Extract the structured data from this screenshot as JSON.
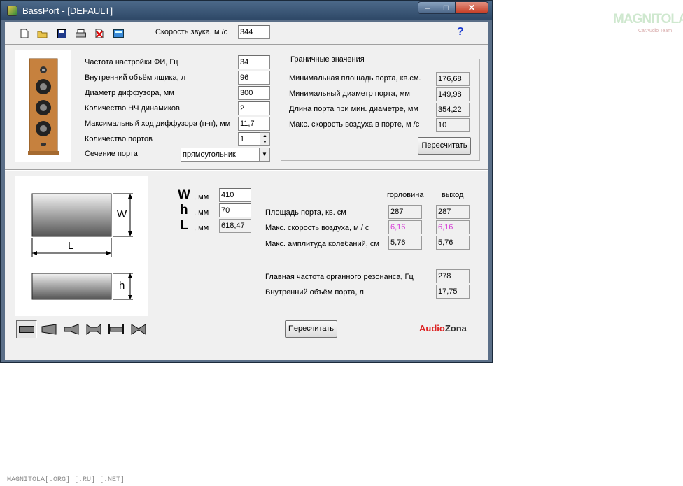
{
  "window": {
    "title": "BassPort - [DEFAULT]",
    "min": "–",
    "max": "□",
    "close": "✕"
  },
  "toolbar": {
    "icons": [
      "new-file-icon",
      "open-folder-icon",
      "save-icon",
      "print-icon",
      "delete-icon",
      "calculator-icon"
    ],
    "sound_speed_label": "Скорость звука, м /с",
    "sound_speed_value": "344",
    "help": "?"
  },
  "params": {
    "tuning_freq": {
      "label": "Частота настройки ФИ, Гц",
      "value": "34"
    },
    "box_volume": {
      "label": "Внутренний объём ящика, л",
      "value": "96"
    },
    "cone_diameter": {
      "label": "Диаметр диффузора, мм",
      "value": "300"
    },
    "driver_count": {
      "label": "Количество НЧ динамиков",
      "value": "2"
    },
    "max_excursion": {
      "label": "Максимальный ход диффузора (п-п), мм",
      "value": "11,7"
    },
    "port_count": {
      "label": "Количество портов",
      "value": "1"
    },
    "port_section": {
      "label": "Сечение порта",
      "value": "прямоугольник"
    }
  },
  "limits": {
    "title": "Граничные значения",
    "min_area": {
      "label": "Минимальная площадь порта, кв.см.",
      "value": "176,68"
    },
    "min_diameter": {
      "label": "Минимальный диаметр порта, мм",
      "value": "149,98"
    },
    "port_length": {
      "label": "Длина порта при мин. диаметре, мм",
      "value": "354,22"
    },
    "max_air_speed": {
      "label": "Макс. скорость воздуха в порте, м /с",
      "value": "10"
    },
    "recalc": "Пересчитать"
  },
  "dimensions": {
    "w": {
      "letter": "W",
      "unit": ", мм",
      "value": "410"
    },
    "h": {
      "letter": "h",
      "unit": ", мм",
      "value": "70"
    },
    "l": {
      "letter": "L",
      "unit": ", мм",
      "value": "618,47"
    },
    "diagram": {
      "w": "W",
      "l": "L",
      "h": "h"
    }
  },
  "results": {
    "col_throat": "горловина",
    "col_exit": "выход",
    "port_area": {
      "label": "Площадь порта, кв. см",
      "throat": "287",
      "exit": "287"
    },
    "max_speed": {
      "label": "Макс. скорость воздуха, м / с",
      "throat": "6,16",
      "exit": "6,16"
    },
    "max_amplitude": {
      "label": "Макс. амплитуда колебаний, см",
      "throat": "5,76",
      "exit": "5,76"
    },
    "organ_resonance": {
      "label": "Главная частота органного резонанса, Гц",
      "value": "278"
    },
    "port_volume": {
      "label": "Внутренний объём порта, л",
      "value": "17,75"
    }
  },
  "bottom": {
    "recalc": "Пересчитать",
    "brand_a": "Audio",
    "brand_b": "Zona",
    "shapes": [
      "rect-port-icon",
      "flared-one-side-icon",
      "horn-port-icon",
      "double-flare-icon",
      "straight-flanged-icon",
      "hourglass-port-icon"
    ]
  },
  "colors": {
    "accent_pink": "#d63bd6",
    "brand_red": "#d22",
    "titlebar": "#3a5677"
  },
  "watermark": {
    "logo": "MAGNITOLA",
    "sub": "CarAudio Team",
    "footer": "MAGNITOLA[.ORG] [.RU] [.NET]"
  }
}
